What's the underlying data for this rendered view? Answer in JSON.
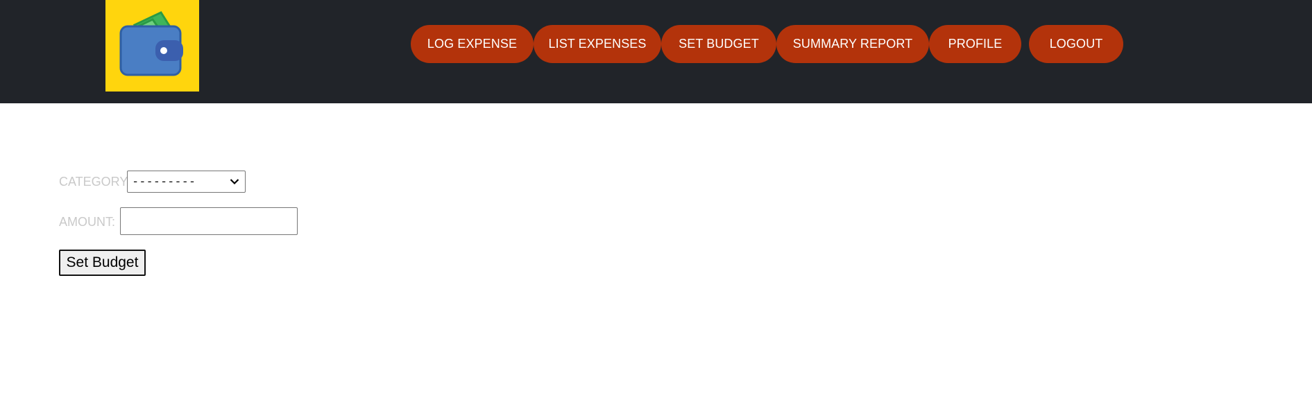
{
  "nav": {
    "logo_icon": "wallet-icon",
    "buttons": [
      {
        "label": "LOG EXPENSE"
      },
      {
        "label": "LIST EXPENSES"
      },
      {
        "label": "SET BUDGET"
      },
      {
        "label": "SUMMARY REPORT"
      },
      {
        "label": "PROFILE"
      },
      {
        "label": "LOGOUT"
      }
    ]
  },
  "form": {
    "category_label": "CATEGORY:",
    "category_selected": "---------",
    "amount_label": "AMOUNT:",
    "amount_value": "",
    "submit_label": "Set Budget"
  },
  "colors": {
    "navbar_bg": "#212429",
    "logo_bg": "#ffd50d",
    "nav_button_bg": "#b3330b",
    "label_text": "#c9c9c9"
  }
}
